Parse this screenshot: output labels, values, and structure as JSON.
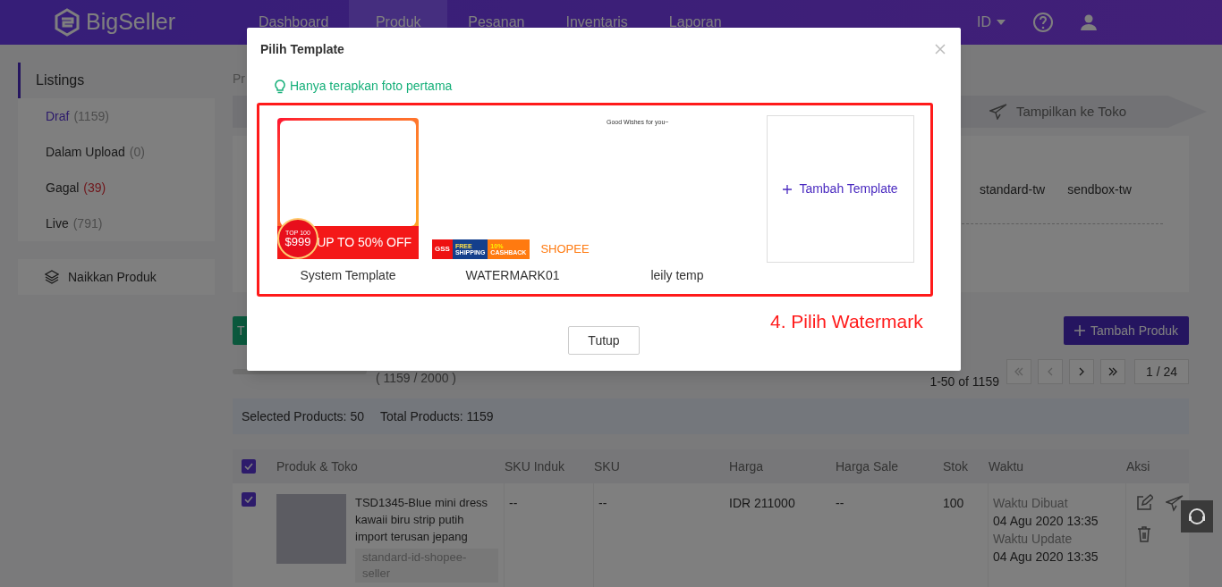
{
  "nav": {
    "logo": "BigSeller",
    "items": [
      {
        "label": "Dashboard",
        "selected": false
      },
      {
        "label": "Produk",
        "selected": true
      },
      {
        "label": "Pesanan",
        "selected": false
      },
      {
        "label": "Inventaris",
        "selected": false
      },
      {
        "label": "Laporan",
        "selected": false
      }
    ],
    "language": "ID"
  },
  "sidebar": {
    "title": "Listings",
    "items": [
      {
        "label": "Draf",
        "count": "(1159)",
        "selected": true,
        "alert": false
      },
      {
        "label": "Dalam Upload",
        "count": "(0)",
        "selected": false,
        "alert": false
      },
      {
        "label": "Gagal",
        "count": "(39)",
        "selected": false,
        "alert": true
      },
      {
        "label": "Live",
        "count": "(791)",
        "selected": false,
        "alert": false
      }
    ],
    "upload": "Naikkan Produk"
  },
  "breadcrumb": "Pr",
  "step": "Tampilkan ke Toko",
  "stores": [
    "standard-tw",
    "sendbox-tw"
  ],
  "green_button": "T",
  "add_product": "Tambah Produk",
  "quota": "( 1159 / 2000 )",
  "pagination": {
    "range": "1-50 of 1159",
    "page": "1 / 24"
  },
  "summary": {
    "selected": "Selected Products: 50",
    "total": "Total Products: 1159"
  },
  "table": {
    "all_checked": true,
    "columns": [
      "Produk & Toko",
      "SKU Induk",
      "SKU",
      "Harga",
      "Harga Sale",
      "Stok",
      "Waktu",
      "Aksi"
    ],
    "rows": [
      {
        "checked": true,
        "name": "TSD1345-Blue mini dress kawaii biru strip putih import terusan jepang",
        "store": "standard-id-shopee-seller",
        "sku_parent": "--",
        "sku": "--",
        "price": "IDR 211000",
        "sale": "--",
        "stock": "100",
        "created_label": "Waktu Dibuat",
        "created": "04 Agu 2020 13:35",
        "updated_label": "Waktu Update",
        "updated": "04 Agu 2020 13:35"
      }
    ]
  },
  "modal": {
    "title": "Pilih Template",
    "hint": "Hanya terapkan foto pertama",
    "templates": [
      {
        "kind": "frame",
        "name": "System Template",
        "texts": [
          "TOP 100",
          "$999",
          "UP TO 50% OFF"
        ]
      },
      {
        "kind": "banner",
        "name": "WATERMARK01",
        "texts": [
          "GSS",
          "FREE",
          "SHIPPING",
          "10%",
          "CASHBACK",
          "SHOPEE"
        ]
      },
      {
        "kind": "caption",
        "name": "leily temp",
        "texts": [
          "Good Wishes for you~"
        ]
      }
    ],
    "add": "Tambah Template",
    "close_button": "Tutup"
  },
  "annotation": "4. Pilih Watermark"
}
